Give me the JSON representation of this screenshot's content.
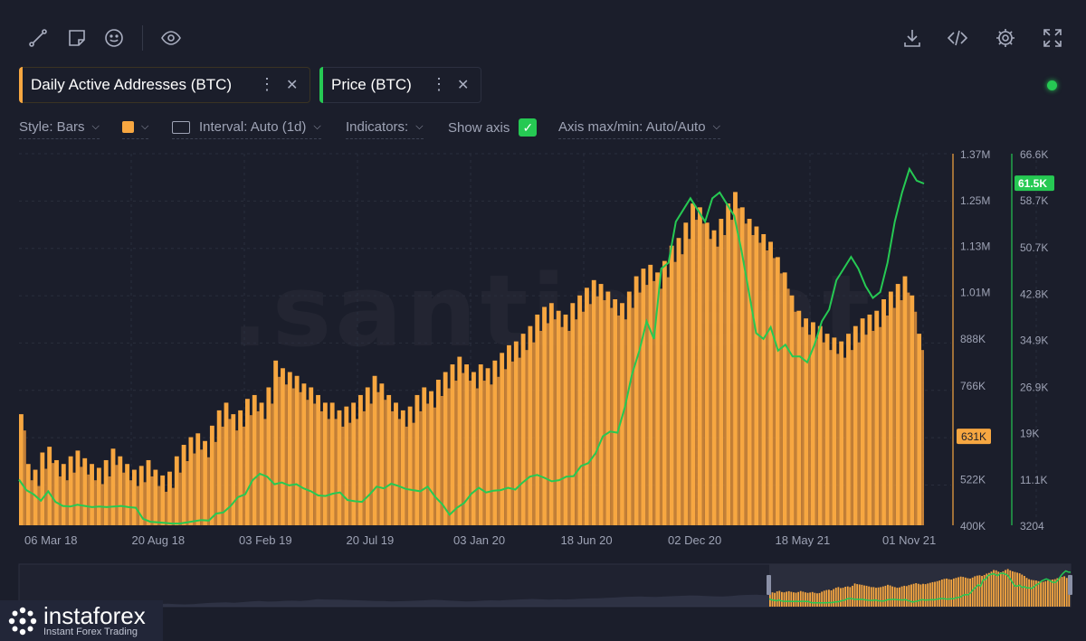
{
  "toolbar": {
    "left_icons": [
      "line-tool-icon",
      "note-icon",
      "emoji-icon",
      "eye-icon"
    ],
    "right_icons": [
      "download-icon",
      "embed-code-icon",
      "settings-icon",
      "fullscreen-icon"
    ]
  },
  "metrics": [
    {
      "label": "Daily Active Addresses (BTC)",
      "color": "#f7a741"
    },
    {
      "label": "Price (BTC)",
      "color": "#26c953"
    }
  ],
  "settings": {
    "style": "Style: Bars",
    "interval": "Interval: Auto (1d)",
    "indicators": "Indicators:",
    "show_axis": "Show axis",
    "axis_maxmin": "Axis max/min: Auto/Auto"
  },
  "watermark": ".santiment",
  "logo": {
    "name": "instaforex",
    "tagline": "Instant Forex Trading"
  },
  "chart_data": {
    "type": "bar",
    "x": [
      "06 Mar 18",
      "20 Aug 18",
      "03 Feb 19",
      "20 Jul 19",
      "03 Jan 20",
      "18 Jun 20",
      "02 Dec 20",
      "18 May 21",
      "01 Nov 21"
    ],
    "x_range": [
      "06 Mar 18",
      "01 Nov 21"
    ],
    "series": [
      {
        "name": "Daily Active Addresses (BTC)",
        "type": "bar",
        "color": "#f7a741",
        "axis": "left",
        "ylim": [
          400000,
          1370000
        ],
        "ticks": [
          "1.37M",
          "1.25M",
          "1.13M",
          "1.01M",
          "888K",
          "766K",
          "522K",
          "400K"
        ],
        "last_value_label": "631K",
        "last_value": 631000,
        "values": [
          690000,
          560000,
          545000,
          590000,
          605000,
          570000,
          560000,
          580000,
          595000,
          575000,
          560000,
          550000,
          570000,
          600000,
          580000,
          560000,
          545000,
          555000,
          570000,
          545000,
          530000,
          540000,
          580000,
          610000,
          630000,
          640000,
          620000,
          660000,
          700000,
          720000,
          690000,
          700000,
          730000,
          740000,
          720000,
          760000,
          830000,
          810000,
          800000,
          790000,
          770000,
          760000,
          740000,
          720000,
          720000,
          700000,
          710000,
          720000,
          740000,
          760000,
          790000,
          770000,
          740000,
          720000,
          700000,
          710000,
          740000,
          760000,
          750000,
          780000,
          800000,
          820000,
          840000,
          820000,
          800000,
          820000,
          810000,
          830000,
          850000,
          870000,
          880000,
          900000,
          920000,
          950000,
          970000,
          980000,
          960000,
          950000,
          980000,
          1000000,
          1020000,
          1040000,
          1030000,
          1010000,
          990000,
          980000,
          1010000,
          1050000,
          1070000,
          1080000,
          1060000,
          1090000,
          1130000,
          1150000,
          1190000,
          1240000,
          1230000,
          1190000,
          1170000,
          1200000,
          1240000,
          1270000,
          1230000,
          1200000,
          1180000,
          1160000,
          1140000,
          1100000,
          1060000,
          1000000,
          960000,
          940000,
          930000,
          920000,
          900000,
          890000,
          880000,
          900000,
          920000,
          940000,
          950000,
          960000,
          990000,
          1010000,
          1030000,
          1050000,
          1000000,
          900000
        ]
      },
      {
        "name": "Price (BTC)",
        "type": "line",
        "color": "#26c953",
        "axis": "right",
        "ylim": [
          3204,
          66600
        ],
        "ticks": [
          "66.6K",
          "58.7K",
          "50.7K",
          "42.8K",
          "34.9K",
          "26.9K",
          "19K",
          "11.1K",
          "3204"
        ],
        "last_value_label": "61.5K",
        "last_value": 61500,
        "values": [
          11000,
          9200,
          8500,
          7400,
          9000,
          7200,
          6500,
          6400,
          6700,
          6500,
          6300,
          6400,
          6300,
          6400,
          6500,
          6300,
          6200,
          4300,
          3800,
          3700,
          3600,
          3500,
          3500,
          3700,
          3900,
          4100,
          4000,
          5200,
          5400,
          6500,
          8000,
          8500,
          10900,
          12000,
          11500,
          10200,
          10500,
          10000,
          10200,
          9500,
          9000,
          8300,
          8200,
          8600,
          8800,
          7500,
          7300,
          7200,
          8400,
          9800,
          9500,
          10300,
          9900,
          9400,
          9200,
          9000,
          9800,
          8100,
          6800,
          5000,
          6200,
          7000,
          8600,
          9600,
          8800,
          9100,
          9200,
          9600,
          9300,
          10500,
          11500,
          11800,
          11300,
          10700,
          10900,
          11500,
          11600,
          13300,
          13800,
          15500,
          18400,
          19200,
          19000,
          23300,
          29000,
          33000,
          38000,
          35000,
          47000,
          48000,
          55000,
          57000,
          59000,
          57000,
          55000,
          59000,
          60000,
          58000,
          56000,
          50000,
          43000,
          36000,
          35000,
          37000,
          33000,
          34000,
          32000,
          32000,
          31000,
          34000,
          38000,
          40000,
          45000,
          47000,
          49000,
          47000,
          44000,
          42000,
          43000,
          48000,
          55000,
          60000,
          64000,
          62000,
          61500
        ]
      }
    ],
    "navigator": true,
    "grid": true
  }
}
